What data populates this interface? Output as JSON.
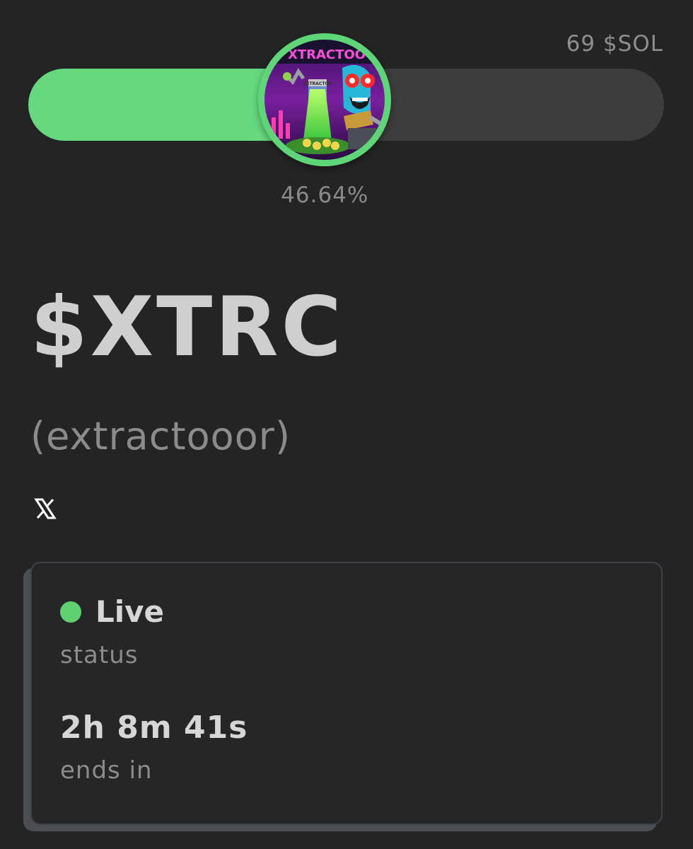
{
  "progress": {
    "goal_label": "69 $SOL",
    "percent_label": "46.64%",
    "fraction": 0.4664,
    "fill_color": "#66d97f",
    "track_color": "#3d3d3d"
  },
  "token": {
    "ticker": "$XTRC",
    "name": "(extractooor)",
    "avatar_text": "XTRACTOO",
    "avatar_label_text": "EXTRACTOR",
    "social_icon": "x-icon"
  },
  "card": {
    "status_value": "Live",
    "status_label": "status",
    "status_color": "#5fd170",
    "countdown_value": "2h 8m 41s",
    "countdown_label": "ends in"
  }
}
